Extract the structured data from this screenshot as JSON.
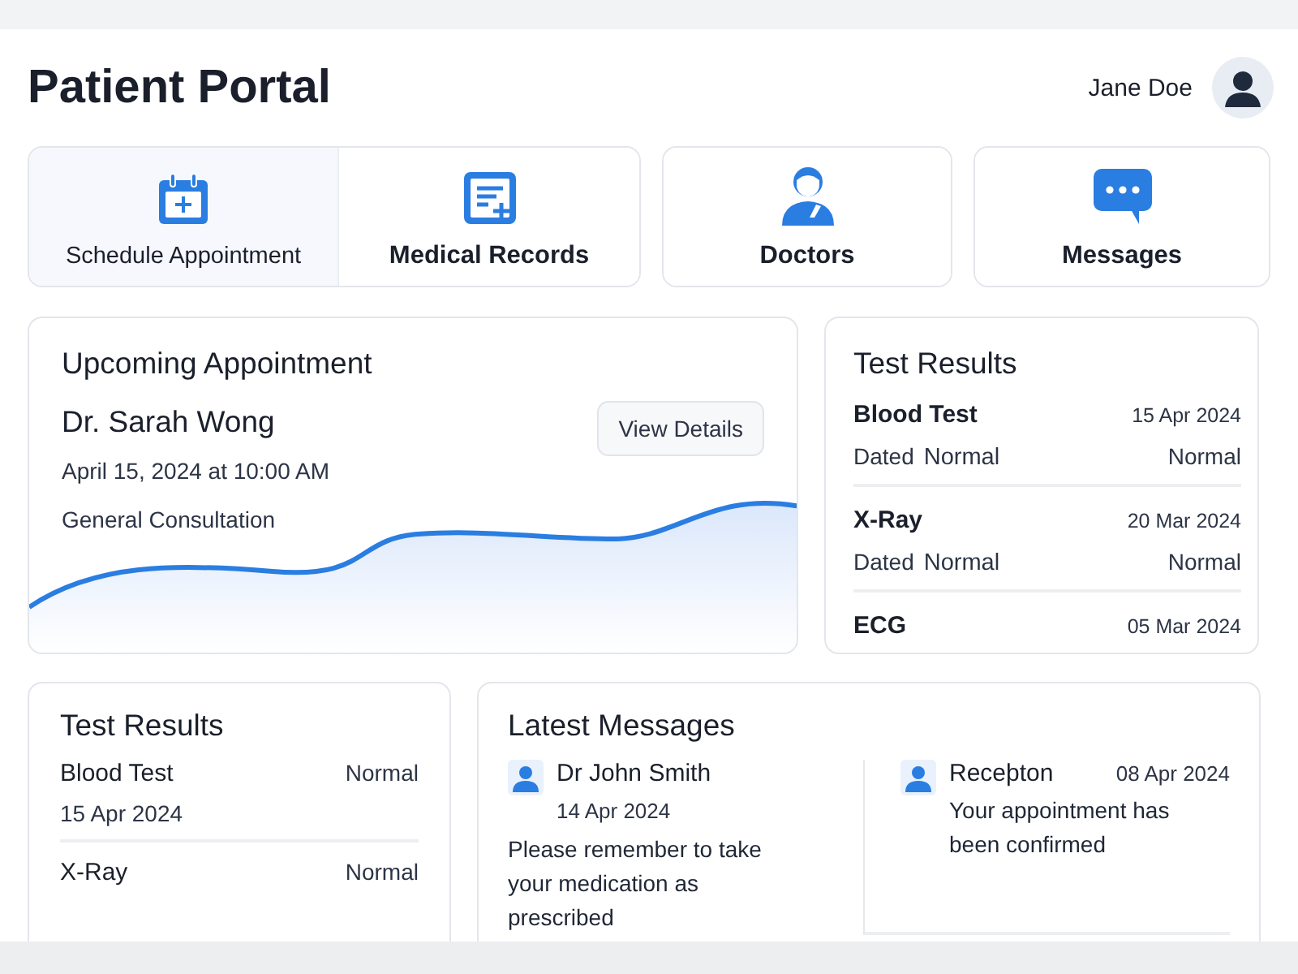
{
  "header": {
    "title": "Patient Portal",
    "user_name": "Jane Doe"
  },
  "nav_tiles": [
    {
      "label": "Schedule Appointment",
      "selected": true
    },
    {
      "label": "Medical Records",
      "selected": false
    },
    {
      "label": "Doctors",
      "selected": false
    },
    {
      "label": "Messages",
      "selected": false
    }
  ],
  "upcoming_appointment": {
    "title": "Upcoming Appointment",
    "doctor": "Dr. Sarah Wong",
    "datetime": "April 15, 2024 at 10:00 AM",
    "type": "General Consultation",
    "button": "View Details"
  },
  "test_results_side": {
    "title": "Test Results",
    "items": [
      {
        "name": "Blood Test",
        "date": "15 Apr 2024",
        "sub_label": "Dated",
        "sub_value": "Normal",
        "status": "Normal"
      },
      {
        "name": "X-Ray",
        "date": "20 Mar 2024",
        "sub_label": "Dated",
        "sub_value": "Normal",
        "status": "Normal"
      },
      {
        "name": "ECG",
        "date": "05 Mar 2024"
      }
    ]
  },
  "test_results": {
    "title": "Test Results",
    "items": [
      {
        "name": "Blood Test",
        "status": "Normal",
        "date": "15 Apr 2024"
      },
      {
        "name": "X-Ray",
        "status": "Normal"
      }
    ]
  },
  "latest_messages": {
    "title": "Latest Messages",
    "items": [
      {
        "kind": "stacked",
        "sender": "Dr John Smith",
        "date": "14 Apr 2024",
        "text": "Please remember to take your medication as prescribed"
      },
      {
        "kind": "inline",
        "sender": "Receþton",
        "date": "08 Apr 2024",
        "text": "Your appointment has been confirmed"
      }
    ]
  }
}
